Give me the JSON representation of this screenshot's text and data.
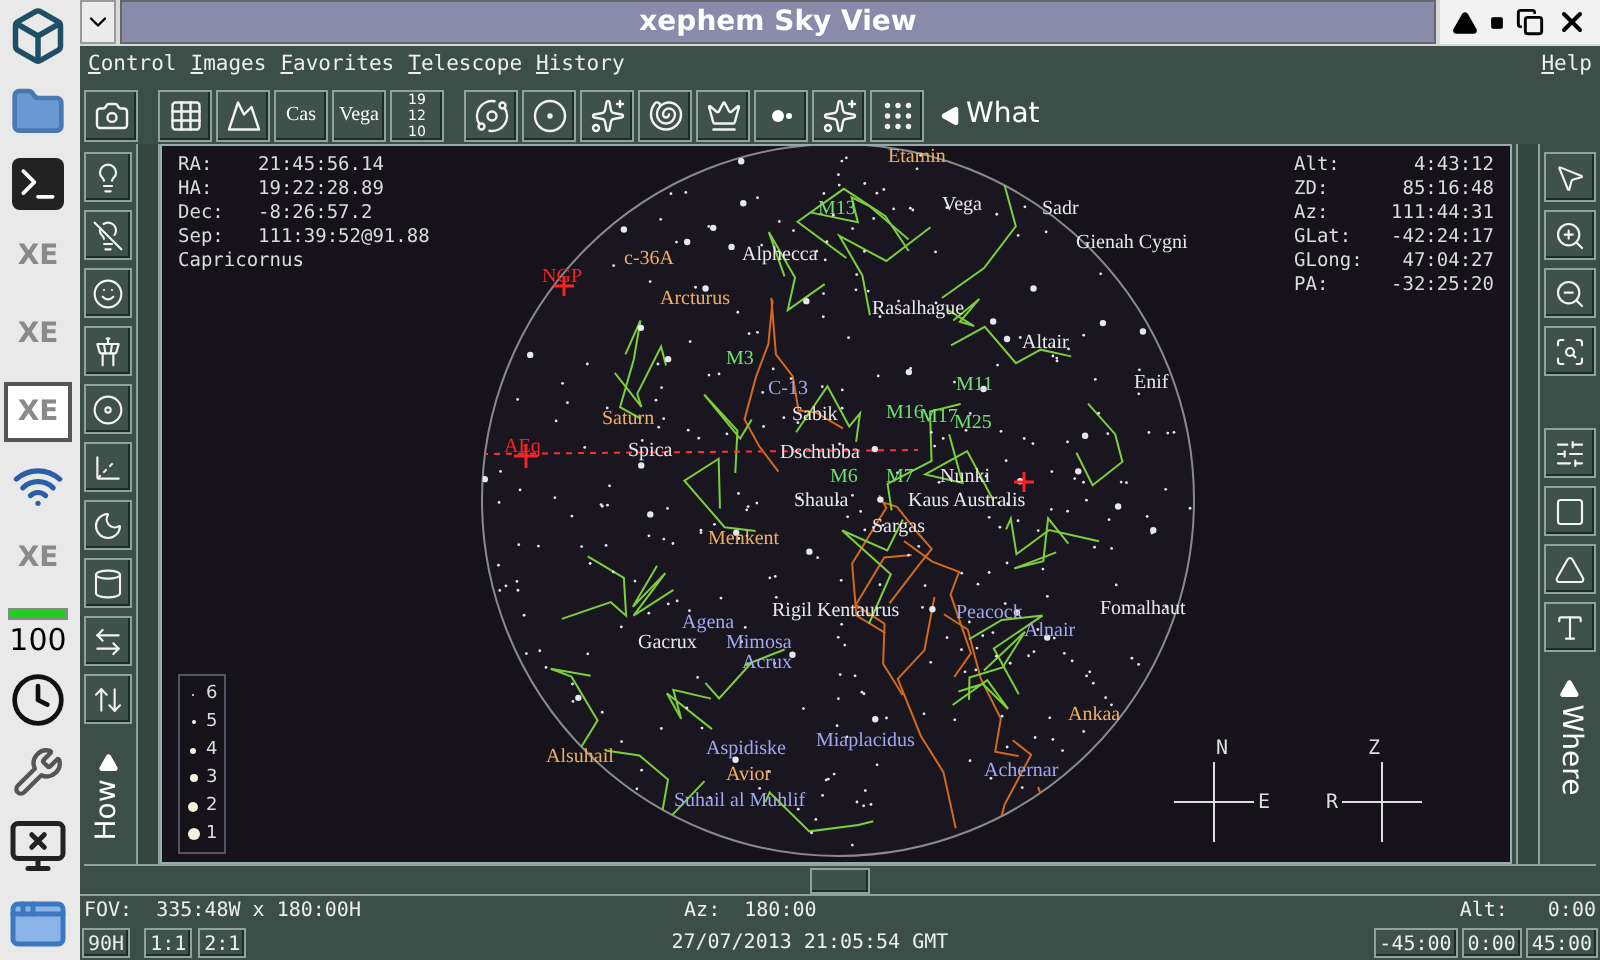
{
  "taskbar": {
    "items": [
      {
        "kind": "logo"
      },
      {
        "kind": "folder"
      },
      {
        "kind": "terminal"
      },
      {
        "kind": "app",
        "label": "XE",
        "selected": false
      },
      {
        "kind": "app",
        "label": "XE",
        "selected": false
      },
      {
        "kind": "app",
        "label": "XE",
        "selected": true
      },
      {
        "kind": "wifi"
      },
      {
        "kind": "app",
        "label": "XE",
        "selected": false
      },
      {
        "kind": "battery",
        "label": "100",
        "level": 1
      },
      {
        "kind": "clock"
      },
      {
        "kind": "settings"
      },
      {
        "kind": "network"
      },
      {
        "kind": "desktop"
      }
    ]
  },
  "window": {
    "title": "xephem Sky View"
  },
  "menu": {
    "items": [
      "Control",
      "Images",
      "Favorites",
      "Telescope",
      "History"
    ],
    "help": "Help"
  },
  "toolbar": {
    "buttons": [
      {
        "kind": "camera"
      },
      {
        "kind": "grid"
      },
      {
        "kind": "landscape"
      },
      {
        "kind": "constellation",
        "label": "Cas"
      },
      {
        "kind": "star-name",
        "label": "Vega"
      },
      {
        "kind": "magnitude",
        "labels": [
          "19",
          "12",
          "10"
        ]
      },
      {
        "kind": "orbit"
      },
      {
        "kind": "planet"
      },
      {
        "kind": "cluster"
      },
      {
        "kind": "galaxy"
      },
      {
        "kind": "knight"
      },
      {
        "kind": "double-star"
      },
      {
        "kind": "stars"
      },
      {
        "kind": "noise"
      }
    ],
    "what": "What"
  },
  "left_tools": {
    "buttons": [
      {
        "kind": "lamp"
      },
      {
        "kind": "lamp-dim"
      },
      {
        "kind": "lamp-face"
      },
      {
        "kind": "tower"
      },
      {
        "kind": "disc"
      },
      {
        "kind": "axes"
      },
      {
        "kind": "moon"
      },
      {
        "kind": "cylinder"
      },
      {
        "kind": "swap-horizontal"
      },
      {
        "kind": "swap-vertical"
      }
    ],
    "how": "How"
  },
  "right_tools": {
    "buttons": [
      {
        "kind": "pointer"
      },
      {
        "kind": "zoom-in"
      },
      {
        "kind": "zoom-out"
      },
      {
        "kind": "zoom-box"
      },
      {
        "kind": "slider"
      },
      {
        "kind": "square"
      },
      {
        "kind": "trapezoid"
      },
      {
        "kind": "letter-a"
      }
    ],
    "where": "Where"
  },
  "map": {
    "info_left": [
      {
        "label": "RA:",
        "value": "21:45:56.14"
      },
      {
        "label": "HA:",
        "value": "19:22:28.89"
      },
      {
        "label": "Dec:",
        "value": "-8:26:57.2"
      },
      {
        "label": "Sep:",
        "value": "111:39:52@91.88"
      }
    ],
    "constellation": "Capricornus",
    "info_right": [
      {
        "label": "Alt:",
        "value": "4:43:12"
      },
      {
        "label": "ZD:",
        "value": "85:16:48"
      },
      {
        "label": "Az:",
        "value": "111:44:31"
      },
      {
        "label": "GLat:",
        "value": "-42:24:17"
      },
      {
        "label": "GLong:",
        "value": "47:04:27"
      },
      {
        "label": "PA:",
        "value": "-32:25:20"
      }
    ],
    "labels": [
      {
        "text": "Etamin",
        "color": "#f0b060"
      },
      {
        "text": "M13",
        "color": "#70e070"
      },
      {
        "text": "Vega",
        "color": "#e8e8e8"
      },
      {
        "text": "Sadr",
        "color": "#e8e8e8"
      },
      {
        "text": "c-36A",
        "color": "#f0b060"
      },
      {
        "text": "Alphecca",
        "color": "#e8e8e8"
      },
      {
        "text": "Gienah Cygni",
        "color": "#e8e8e8"
      },
      {
        "text": "NGP",
        "color": "#ff2020"
      },
      {
        "text": "Arcturus",
        "color": "#f0b060"
      },
      {
        "text": "Rasalhague",
        "color": "#e8e8e8"
      },
      {
        "text": "M3",
        "color": "#70e070"
      },
      {
        "text": "Altair",
        "color": "#e8e8e8"
      },
      {
        "text": "C-13",
        "color": "#a0a8f0"
      },
      {
        "text": "M11",
        "color": "#70e070"
      },
      {
        "text": "Enif",
        "color": "#e8e8e8"
      },
      {
        "text": "Saturn",
        "color": "#f0b060"
      },
      {
        "text": "Sabik",
        "color": "#e8e8e8"
      },
      {
        "text": "M16",
        "color": "#70e070"
      },
      {
        "text": "M17",
        "color": "#70e070"
      },
      {
        "text": "M25",
        "color": "#70e070"
      },
      {
        "text": "AEq",
        "color": "#ff2020"
      },
      {
        "text": "Spica",
        "color": "#e8e8e8"
      },
      {
        "text": "Dschubba",
        "color": "#e8e8e8"
      },
      {
        "text": "M6",
        "color": "#70e070"
      },
      {
        "text": "M7",
        "color": "#70e070"
      },
      {
        "text": "Nunki",
        "color": "#e8e8e8"
      },
      {
        "text": "Shaula",
        "color": "#e8e8e8"
      },
      {
        "text": "Kaus Australis",
        "color": "#e8e8e8"
      },
      {
        "text": "Menkent",
        "color": "#f0b060"
      },
      {
        "text": "Sargas",
        "color": "#e8e8e8"
      },
      {
        "text": "Gacrux",
        "color": "#e8e8e8"
      },
      {
        "text": "Agena",
        "color": "#a0a8f0"
      },
      {
        "text": "Mimosa",
        "color": "#a0a8f0"
      },
      {
        "text": "Acrux",
        "color": "#a0a8f0"
      },
      {
        "text": "Rigil Kentaurus",
        "color": "#e8e8e8"
      },
      {
        "text": "Peacock",
        "color": "#a0a8f0"
      },
      {
        "text": "Alnair",
        "color": "#a0a8f0"
      },
      {
        "text": "Fomalhaut",
        "color": "#e8e8e8"
      },
      {
        "text": "Ankaa",
        "color": "#f0b060"
      },
      {
        "text": "Alsuhail",
        "color": "#f0b060"
      },
      {
        "text": "Aspidiske",
        "color": "#a0a8f0"
      },
      {
        "text": "Avior",
        "color": "#f0b060"
      },
      {
        "text": "Miaplacidus",
        "color": "#a0a8f0"
      },
      {
        "text": "Achernar",
        "color": "#a0a8f0"
      },
      {
        "text": "Suhail al Muhlif",
        "color": "#a0a8f0"
      }
    ],
    "legend": [
      "6",
      "5",
      "4",
      "3",
      "2",
      "1"
    ],
    "compass": [
      {
        "top": "N",
        "right": "E"
      },
      {
        "top": "Z",
        "left": "R"
      }
    ]
  },
  "status": {
    "fov": "FOV:  335:48W x 180:00H",
    "az": "Az:  180:00",
    "alt_label": "Alt:",
    "alt_value": "0:00",
    "date": "27/07/2013 21:05:54 GMT",
    "left_buttons": [
      "90H",
      "1:1",
      "2:1"
    ],
    "right_buttons": [
      "-45:00",
      "0:00",
      "45:00"
    ]
  }
}
